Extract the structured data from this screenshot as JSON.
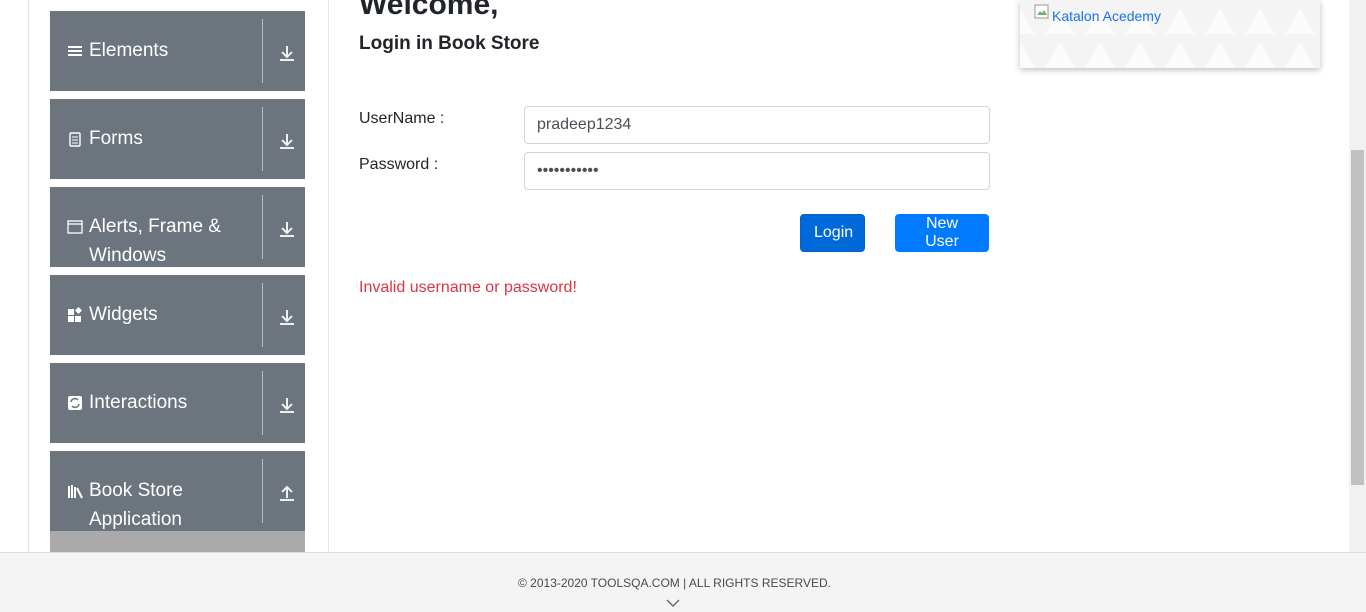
{
  "sidebar": {
    "groups": [
      {
        "label": "Elements",
        "icon": "hamburger-icon",
        "arrow": "download-arrow-icon"
      },
      {
        "label": "Forms",
        "icon": "form-document-icon",
        "arrow": "download-arrow-icon"
      },
      {
        "label": "Alerts, Frame & Windows",
        "icon": "window-icon",
        "arrow": "download-arrow-icon"
      },
      {
        "label": "Widgets",
        "icon": "widgets-icon",
        "arrow": "download-arrow-icon"
      },
      {
        "label": "Interactions",
        "icon": "interactions-icon",
        "arrow": "download-arrow-icon"
      },
      {
        "label": "Book Store Application",
        "icon": "books-icon",
        "arrow": "upload-arrow-icon"
      }
    ]
  },
  "main": {
    "title": "Welcome,",
    "subtitle": "Login in Book Store",
    "username_label": "UserName :",
    "username_value": "pradeep1234",
    "password_label": "Password :",
    "password_value": "•••••••••••",
    "login_button": "Login",
    "new_user_button": "New User",
    "error_message": "Invalid username or password!"
  },
  "ad": {
    "alt_text": "Katalon Acedemy"
  },
  "footer": {
    "copyright": "© 2013-2020 TOOLSQA.COM | ALL RIGHTS RESERVED."
  },
  "colors": {
    "sidebar_bg": "#6c757d",
    "primary": "#007bff",
    "error": "#dc3545"
  }
}
